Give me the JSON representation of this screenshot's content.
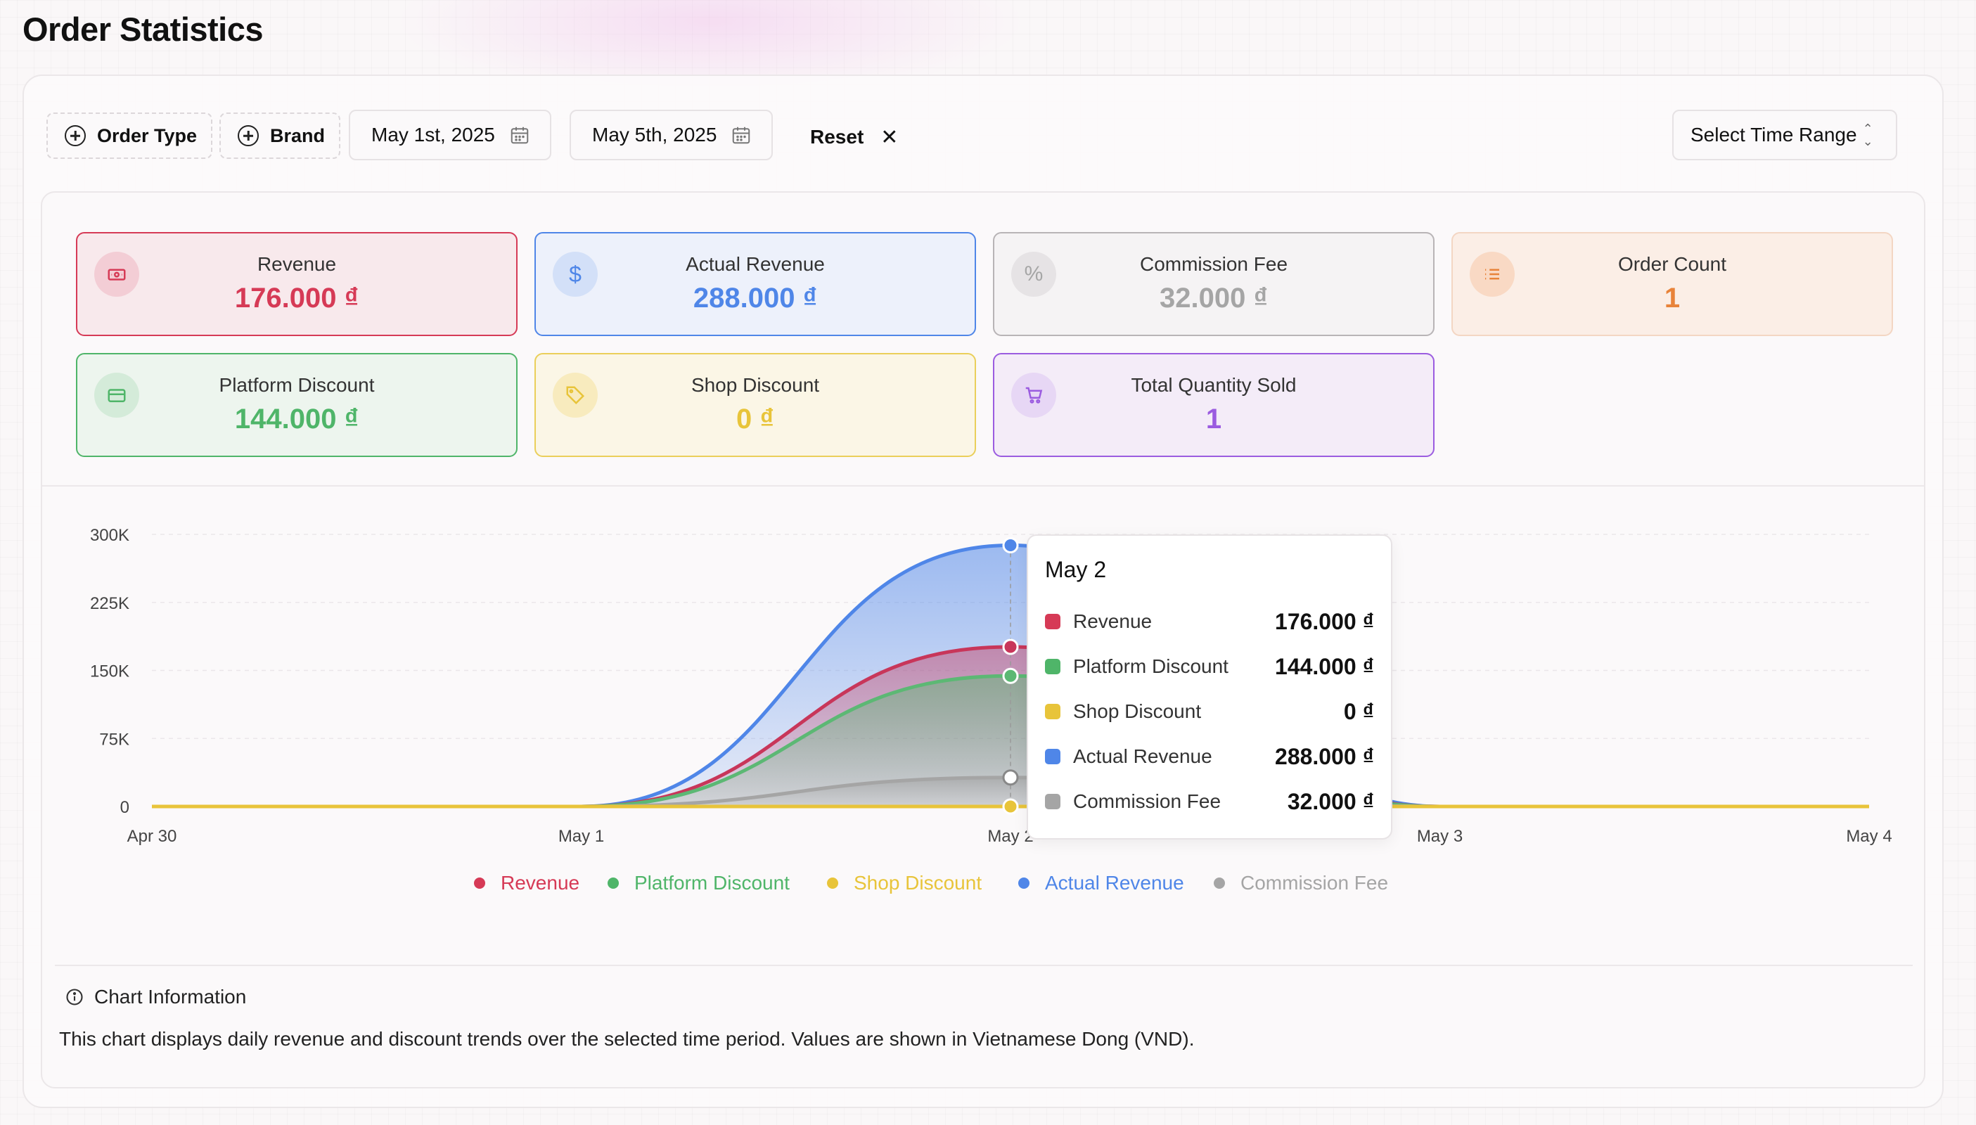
{
  "page": {
    "title": "Order Statistics"
  },
  "toolbar": {
    "order_type_label": "Order Type",
    "brand_label": "Brand",
    "start_date": "May 1st, 2025",
    "end_date": "May 5th, 2025",
    "reset_label": "Reset",
    "time_range_label": "Select Time Range"
  },
  "stats": [
    {
      "label": "Revenue",
      "value": "176.000 ₫",
      "icon": "banknote-icon",
      "color": "#d63a56"
    },
    {
      "label": "Actual Revenue",
      "value": "288.000 ₫",
      "icon": "dollar-icon",
      "color": "#4f86e8"
    },
    {
      "label": "Commission Fee",
      "value": "32.000 ₫",
      "icon": "percent-icon",
      "color": "#a5a5a5"
    },
    {
      "label": "Order Count",
      "value": "1",
      "icon": "list-icon",
      "color": "#e8833a"
    },
    {
      "label": "Platform Discount",
      "value": "144.000 ₫",
      "icon": "credit-card-icon",
      "color": "#4fb569"
    },
    {
      "label": "Shop Discount",
      "value": "0 ₫",
      "icon": "tag-icon",
      "color": "#e8c43a"
    },
    {
      "label": "Total Quantity Sold",
      "value": "1",
      "icon": "cart-icon",
      "color": "#9b5ce0"
    }
  ],
  "chart_data": {
    "type": "area",
    "x": [
      "Apr 30",
      "May 1",
      "May 2",
      "May 3",
      "May 4"
    ],
    "y_ticks": [
      "0",
      "75K",
      "150K",
      "225K",
      "300K"
    ],
    "ylim": [
      0,
      300000
    ],
    "grid": true,
    "legend_position": "bottom",
    "series": [
      {
        "name": "Revenue",
        "color": "#c8365a",
        "values": [
          0,
          0,
          176000,
          0,
          0
        ]
      },
      {
        "name": "Platform Discount",
        "color": "#5cb874",
        "values": [
          0,
          0,
          144000,
          0,
          0
        ]
      },
      {
        "name": "Shop Discount",
        "color": "#e8c43a",
        "values": [
          0,
          0,
          0,
          0,
          0
        ]
      },
      {
        "name": "Actual Revenue",
        "color": "#4f86e8",
        "values": [
          0,
          0,
          288000,
          0,
          0
        ]
      },
      {
        "name": "Commission Fee",
        "color": "#a5a5a5",
        "values": [
          0,
          0,
          32000,
          0,
          0
        ]
      }
    ]
  },
  "tooltip": {
    "title": "May 2",
    "rows": [
      {
        "name": "Revenue",
        "value": "176.000 ₫",
        "color": "#d63a56"
      },
      {
        "name": "Platform Discount",
        "value": "144.000 ₫",
        "color": "#4fb569"
      },
      {
        "name": "Shop Discount",
        "value": "0 ₫",
        "color": "#e8c43a"
      },
      {
        "name": "Actual Revenue",
        "value": "288.000 ₫",
        "color": "#4f86e8"
      },
      {
        "name": "Commission Fee",
        "value": "32.000 ₫",
        "color": "#a5a5a5"
      }
    ]
  },
  "legend": [
    {
      "name": "Revenue",
      "color": "#d63a56"
    },
    {
      "name": "Platform Discount",
      "color": "#4fb569"
    },
    {
      "name": "Shop Discount",
      "color": "#e8c43a"
    },
    {
      "name": "Actual Revenue",
      "color": "#4f86e8"
    },
    {
      "name": "Commission Fee",
      "color": "#a5a5a5"
    }
  ],
  "info": {
    "title": "Chart Information",
    "description": "This chart displays daily revenue and discount trends over the selected time period. Values are shown in Vietnamese Dong (VND)."
  }
}
